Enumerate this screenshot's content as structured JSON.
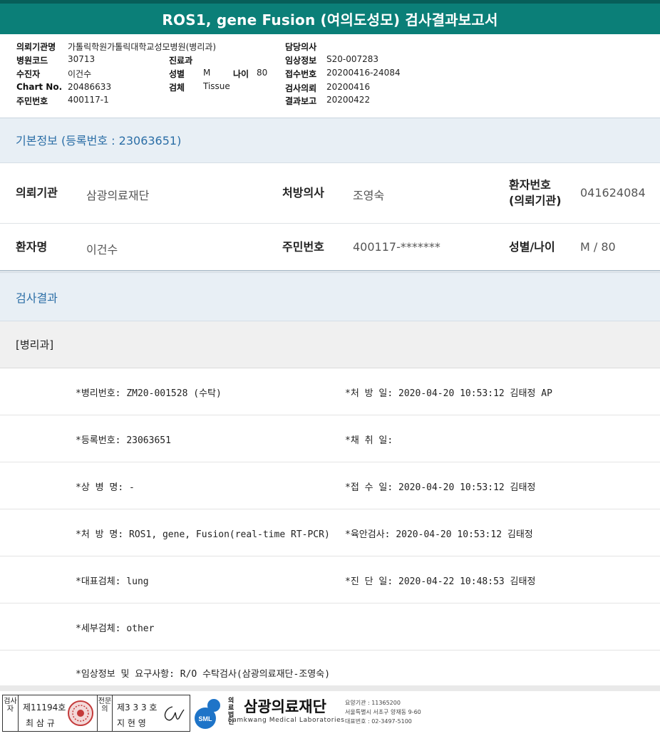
{
  "title": "ROS1, gene Fusion (여의도성모) 검사결과보고서",
  "header": {
    "left": [
      {
        "label": "의뢰기관명",
        "value": "가톨릭학원가톨릭대학교성모병원(병리과)"
      },
      {
        "label": "병원코드",
        "value": "30713"
      },
      {
        "label": "수진자",
        "value": "이건수"
      },
      {
        "label": "Chart No.",
        "value": "20486633"
      },
      {
        "label": "주민번호",
        "value": "400117-1"
      }
    ],
    "mid": [
      {
        "label": "진료과",
        "value": ""
      },
      {
        "label": "성별",
        "value": "M"
      },
      {
        "label": "검체",
        "value": "Tissue"
      }
    ],
    "age_label": "나이",
    "age_value": "80",
    "right": [
      {
        "label": "담당의사",
        "value": ""
      },
      {
        "label": "임상정보",
        "value": "S20-007283"
      },
      {
        "label": "접수번호",
        "value": "20200416-24084"
      },
      {
        "label": "검사의뢰",
        "value": "20200416"
      },
      {
        "label": "결과보고",
        "value": "20200422"
      }
    ]
  },
  "basic_info": {
    "heading": "기본정보 (등록번호 : 23063651)",
    "institution_label": "의뢰기관",
    "institution": "삼광의료재단",
    "doctor_label": "처방의사",
    "doctor": "조영숙",
    "patient_no_label_1": "환자번호",
    "patient_no_label_2": "(의뢰기관)",
    "patient_no": "041624084",
    "patient_name_label": "환자명",
    "patient_name": "이건수",
    "rrn_label": "주민번호",
    "rrn": "400117-*******",
    "sex_age_label": "성별/나이",
    "sex_age": "M / 80"
  },
  "results": {
    "heading": "검사결과",
    "department": "[병리과]",
    "rows": [
      {
        "left": "*병리번호: ZM20-001528 (수탁)",
        "right": "*처 방 일: 2020-04-20 10:53:12  김태정 AP"
      },
      {
        "left": "*등록번호: 23063651",
        "right": "*채 취 일:"
      },
      {
        "left": "*상 병 명: -",
        "right": "*접 수 일: 2020-04-20 10:53:12  김태정"
      },
      {
        "left": "*처 방 명: ROS1, gene, Fusion(real-time RT-PCR)",
        "right": "*육안검사: 2020-04-20 10:53:12  김태정"
      },
      {
        "left": "*대표검체: lung",
        "right": "*진 단 일: 2020-04-22 10:48:53  김태정"
      },
      {
        "left": "*세부검체: other",
        "right": ""
      },
      {
        "left": "*임상정보 및 요구사항: R/O 수탁검사(삼광의료재단-조영숙)",
        "right": ""
      }
    ]
  },
  "footer": {
    "examiner_label": "검사자",
    "examiner_cert": "제11194호",
    "examiner_name": "최 삼 규",
    "specialist_label": "전문의",
    "specialist_cert": "제3 3 3 호",
    "specialist_name": "지 현 영",
    "org_prefix_1": "의료",
    "org_prefix_2": "법인",
    "org_name": "삼광의료재단",
    "org_en": "Samkwang Medical Laboratories",
    "logo_abbr": "SML",
    "info_1": "요양기관 : 11365200",
    "info_2": "서울특별시 서초구 양재동 9-60",
    "info_3": "대표번호 : 02-3497-5100"
  }
}
